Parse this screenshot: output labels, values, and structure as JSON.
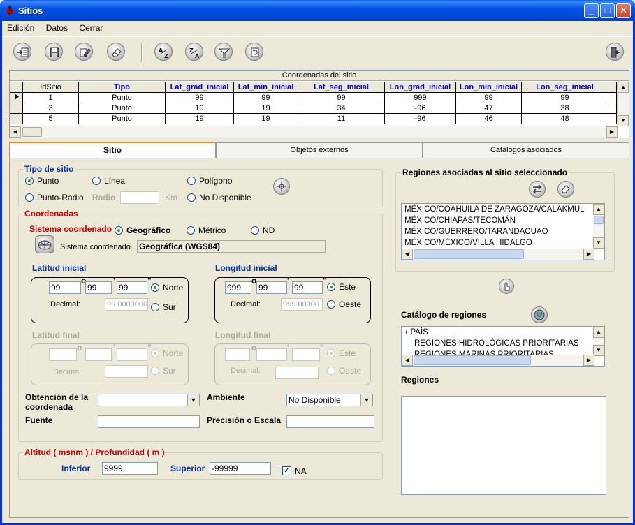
{
  "window": {
    "title": "Sitios",
    "minimize": "_",
    "maximize": "□",
    "close": "✕"
  },
  "menu": {
    "items": [
      "Edición",
      "Datos",
      "Cerrar"
    ]
  },
  "toolbar": {
    "icons": [
      "insert-record-icon",
      "save-icon",
      "edit-icon",
      "erase-icon",
      "sort-asc-icon",
      "sort-desc-icon",
      "filter-icon",
      "refresh-icon",
      "exit-icon"
    ]
  },
  "grid": {
    "caption": "Coordenadas del sitio",
    "columns": [
      "IdSitio",
      "Tipo",
      "Lat_grad_inicial",
      "Lat_min_inicial",
      "Lat_seg_inicial",
      "Lon_grad_inicial",
      "Lon_min_inicial",
      "Lon_seg_inicial"
    ],
    "rows": [
      [
        "1",
        "Punto",
        "99",
        "99",
        "99",
        "999",
        "99",
        "99"
      ],
      [
        "3",
        "Punto",
        "19",
        "19",
        "34",
        "-96",
        "47",
        "38"
      ],
      [
        "5",
        "Punto",
        "19",
        "19",
        "11",
        "-96",
        "46",
        "48"
      ]
    ]
  },
  "tabs": [
    "Sitio",
    "Objetos externos",
    "Catálogos asociados"
  ],
  "tipo_sitio": {
    "legend": "Tipo de sitio",
    "options": {
      "punto": "Punto",
      "linea": "Línea",
      "poligono": "Polígono",
      "punto_radio": "Punto-Radio",
      "no_disponible": "No Disponible"
    },
    "selected": "Punto",
    "radio_label": "Radio",
    "radio_value": "",
    "radio_unit": "Km"
  },
  "coordenadas": {
    "legend": "Coordenadas",
    "sistema_label": "Sistema coordenado",
    "sistema_options": {
      "geo": "Geográfico",
      "metrico": "Métrico",
      "nd": "ND"
    },
    "sistema_selected": "Geográfico",
    "sistema_field_label": "Sistema coordenado",
    "sistema_field_value": "Geográfica (WGS84)",
    "lat_ini": {
      "title": "Latitud inicial",
      "grad": "99",
      "min": "99",
      "seg": "99",
      "decimal_label": "Decimal:",
      "decimal": "99.0000000",
      "norte": "Norte",
      "sur": "Sur",
      "selected": "Norte"
    },
    "lon_ini": {
      "title": "Longitud inicial",
      "grad": "999",
      "min": "99",
      "seg": "99",
      "decimal_label": "Decimal:",
      "decimal": "999.00000",
      "este": "Este",
      "oeste": "Oeste",
      "selected": "Este"
    },
    "lat_fin": {
      "title": "Latitud final",
      "decimal_label": "Decimal:",
      "norte": "Norte",
      "sur": "Sur",
      "selected": "Norte"
    },
    "lon_fin": {
      "title": "Longitud final",
      "decimal_label": "Decimal:",
      "este": "Este",
      "oeste": "Oeste",
      "selected": "Este"
    },
    "deg_sym": "o",
    "min_sym": "'",
    "sec_sym": "\"",
    "obtencion_label_1": "Obtención de la",
    "obtencion_label_2": "coordenada",
    "obtencion_value": "",
    "ambiente_label": "Ambiente",
    "ambiente_value": "No Disponible",
    "fuente_label": "Fuente",
    "fuente_value": "",
    "precision_label": "Precisión o Escala",
    "precision_value": ""
  },
  "altitud": {
    "legend": "Altitud ( msnm ) / Profundidad ( m )",
    "inferior_label": "Inferior",
    "inferior": "9999",
    "superior_label": "Superior",
    "superior": "-99999",
    "na_label": "NA",
    "na_checked": true
  },
  "regiones_asociadas": {
    "title": "Regiones asociadas al sitio seleccionado",
    "items": [
      "MÉXICO/COAHUILA DE ZARAGOZA/CALAKMUL",
      "MÉXICO/CHIAPAS/TECOMÁN",
      "MÉXICO/GUERRERO/TARANDACUAO",
      "MÉXICO/MÉXICO/VILLA HIDALGO"
    ]
  },
  "catalogo": {
    "title": "Catálogo de regiones",
    "items": [
      "PAÍS",
      "REGIONES HIDROLÓGICAS PRIORITARIAS",
      "REGIONES MARINAS PRIORITARIAS"
    ],
    "expander": "+"
  },
  "regiones": {
    "title": "Regiones",
    "items": []
  },
  "colors": {
    "accent": "#0033aa",
    "warning": "#cc0000",
    "titlebar": "#0053e6"
  }
}
